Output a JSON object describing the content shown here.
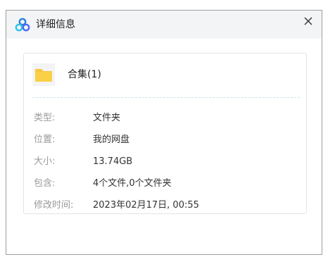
{
  "dialog": {
    "title": "详细信息",
    "close_glyph": "✕",
    "icon": "baidu-netdisk-icon",
    "brand_color": "#2b7fe0"
  },
  "file": {
    "name": "合集(1)",
    "icon": "folder-icon",
    "icon_color": "#f7c73f"
  },
  "details": [
    {
      "label": "类型:",
      "value": "文件夹"
    },
    {
      "label": "位置:",
      "value": "我的网盘"
    },
    {
      "label": "大小:",
      "value": "13.74GB"
    },
    {
      "label": "包含:",
      "value": "4个文件,0个文件夹"
    },
    {
      "label": "修改时间:",
      "value": "2023年02月17日, 00:55"
    }
  ]
}
